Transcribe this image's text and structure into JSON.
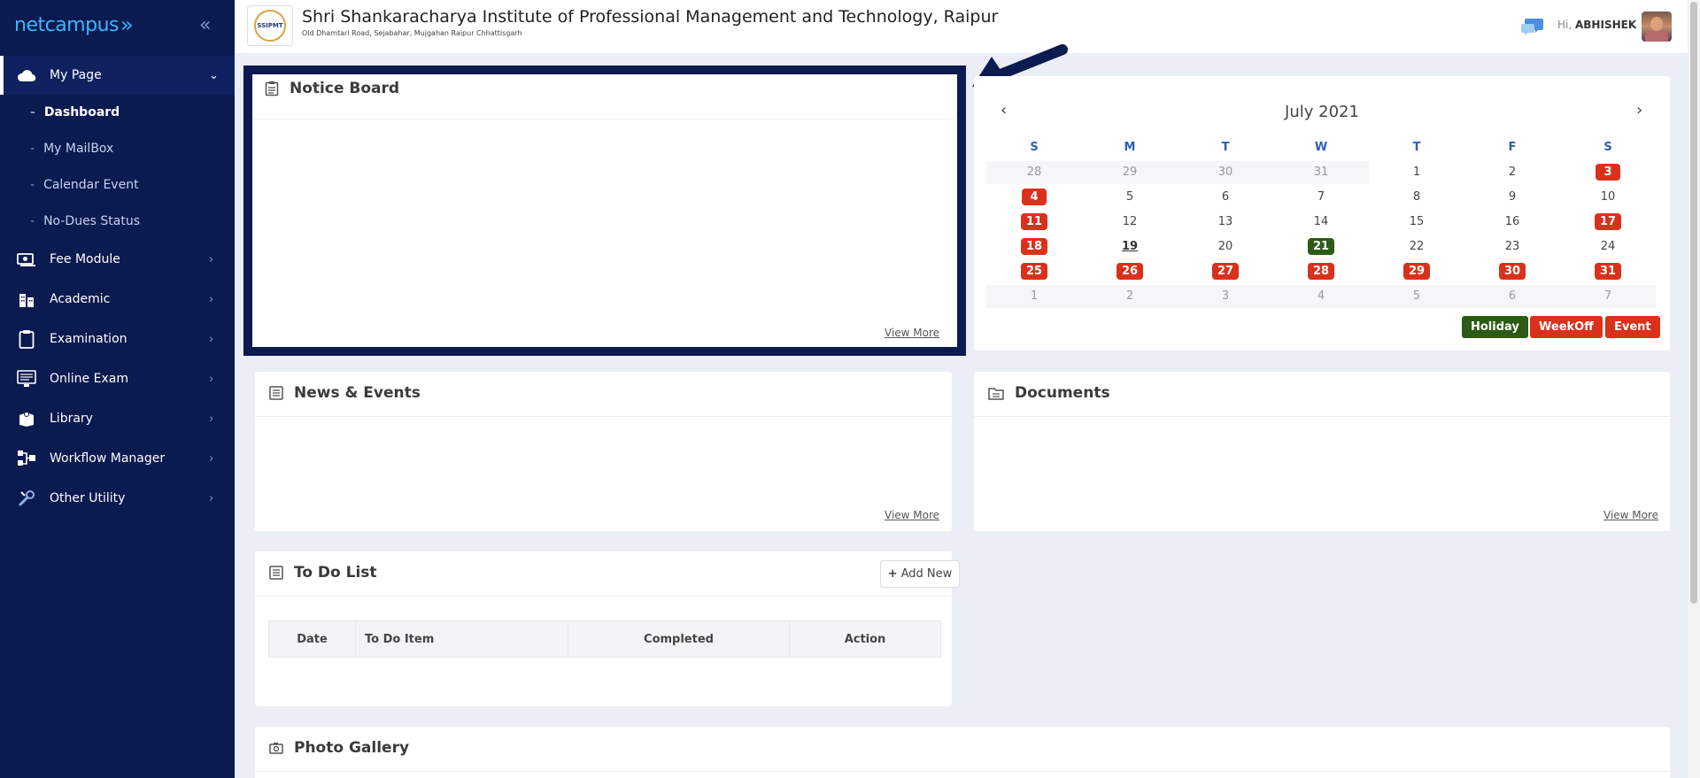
{
  "brand": {
    "name": "netcampus",
    "logo_glyph": "»"
  },
  "header": {
    "logo_text": "SSIPMT",
    "institute_name": "Shri Shankaracharya Institute of Professional Management and Technology, Raipur",
    "address": "Old Dhamtari Road, Sejabahar, Mujgahan Raipur Chhattisgarh",
    "greeting_prefix": "Hi,",
    "user_name": "ABHISHEK"
  },
  "sidebar": {
    "collapse_glyph": "«",
    "items": [
      {
        "label": "My Page",
        "icon": "cloud-icon",
        "expanded": true
      },
      {
        "label": "Fee Module",
        "icon": "money-icon"
      },
      {
        "label": "Academic",
        "icon": "building-icon"
      },
      {
        "label": "Examination",
        "icon": "clipboard-icon"
      },
      {
        "label": "Online Exam",
        "icon": "monitor-icon"
      },
      {
        "label": "Library",
        "icon": "book-icon"
      },
      {
        "label": "Workflow Manager",
        "icon": "workflow-icon"
      },
      {
        "label": "Other Utility",
        "icon": "tools-icon"
      }
    ],
    "sub_items": [
      {
        "label": "Dashboard",
        "active": true
      },
      {
        "label": "My MailBox"
      },
      {
        "label": "Calendar Event"
      },
      {
        "label": "No-Dues Status"
      }
    ]
  },
  "notice_board": {
    "title": "Notice Board",
    "view_more": "View More"
  },
  "news_events": {
    "title": "News & Events",
    "view_more": "View More"
  },
  "documents": {
    "title": "Documents",
    "view_more": "View More"
  },
  "todo": {
    "title": "To Do List",
    "add_new": "Add New",
    "columns": [
      "Date",
      "To Do Item",
      "Completed",
      "Action"
    ]
  },
  "photo_gallery": {
    "title": "Photo Gallery"
  },
  "calendar": {
    "month_label": "July 2021",
    "prev_glyph": "‹",
    "next_glyph": "›",
    "weekdays": [
      "S",
      "M",
      "T",
      "W",
      "T",
      "F",
      "S"
    ],
    "weeks": [
      [
        {
          "d": "28",
          "t": "other"
        },
        {
          "d": "29",
          "t": "other"
        },
        {
          "d": "30",
          "t": "other"
        },
        {
          "d": "31",
          "t": "other"
        },
        {
          "d": "1"
        },
        {
          "d": "2"
        },
        {
          "d": "3",
          "t": "weekoff"
        }
      ],
      [
        {
          "d": "4",
          "t": "weekoff"
        },
        {
          "d": "5"
        },
        {
          "d": "6"
        },
        {
          "d": "7"
        },
        {
          "d": "8"
        },
        {
          "d": "9"
        },
        {
          "d": "10"
        }
      ],
      [
        {
          "d": "11",
          "t": "weekoff"
        },
        {
          "d": "12"
        },
        {
          "d": "13"
        },
        {
          "d": "14"
        },
        {
          "d": "15"
        },
        {
          "d": "16"
        },
        {
          "d": "17",
          "t": "weekoff"
        }
      ],
      [
        {
          "d": "18",
          "t": "weekoff"
        },
        {
          "d": "19",
          "t": "today"
        },
        {
          "d": "20"
        },
        {
          "d": "21",
          "t": "holiday"
        },
        {
          "d": "22"
        },
        {
          "d": "23"
        },
        {
          "d": "24"
        }
      ],
      [
        {
          "d": "25",
          "t": "weekoff"
        },
        {
          "d": "26",
          "t": "weekoff"
        },
        {
          "d": "27",
          "t": "weekoff"
        },
        {
          "d": "28",
          "t": "weekoff"
        },
        {
          "d": "29",
          "t": "weekoff"
        },
        {
          "d": "30",
          "t": "weekoff"
        },
        {
          "d": "31",
          "t": "weekoff"
        }
      ],
      [
        {
          "d": "1",
          "t": "other"
        },
        {
          "d": "2",
          "t": "other"
        },
        {
          "d": "3",
          "t": "other"
        },
        {
          "d": "4",
          "t": "other"
        },
        {
          "d": "5",
          "t": "other"
        },
        {
          "d": "6",
          "t": "other"
        },
        {
          "d": "7",
          "t": "other"
        }
      ]
    ],
    "legend": [
      {
        "label": "Holiday",
        "color": "#2d5a14"
      },
      {
        "label": "WeekOff",
        "color": "#d9311b"
      },
      {
        "label": "Event",
        "color": "#d9311b"
      }
    ]
  },
  "colors": {
    "sidebar_bg": "#0b1a4f",
    "accent_blue": "#2c5fb3",
    "weekoff_red": "#d9311b",
    "holiday_green": "#2d5a14"
  }
}
